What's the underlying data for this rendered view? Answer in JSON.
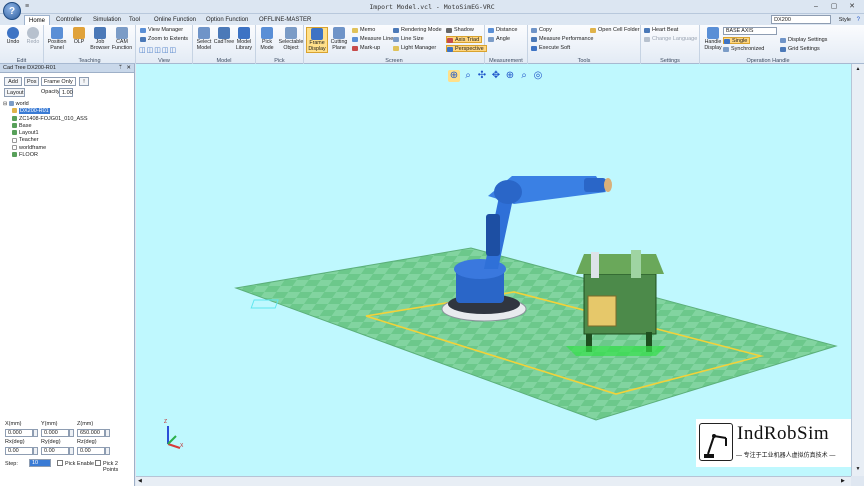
{
  "window": {
    "title": "Import Model.vcl - MotoSimEG-VRC",
    "orb_label": "?",
    "qat_label": "≡",
    "minimize": "–",
    "maximize": "▢",
    "close": "✕"
  },
  "tabs": [
    "Home",
    "Controller",
    "Simulation",
    "Tool",
    "Online Function",
    "Option Function",
    "OFFLINE-MASTER"
  ],
  "active_tab": "Home",
  "controller_select": "DX200",
  "style_label": "Style",
  "ribbon": {
    "edit": {
      "label": "Edit",
      "undo": "Undo",
      "redo": "Redo"
    },
    "teaching": {
      "label": "Teaching",
      "position_panel": "Position Panel",
      "olp": "OLP",
      "job_browser": "Job Browser",
      "cam_function": "CAM Function"
    },
    "view": {
      "label": "View",
      "view_manager": "View Manager",
      "zoom_to_extents": "Zoom to Extents"
    },
    "model": {
      "label": "Model",
      "select_model": "Select Model",
      "cadtree": "CadTree",
      "model_library": "Model Library"
    },
    "pick": {
      "label": "Pick",
      "pick_mode": "Pick Mode",
      "selectable_object": "Selectable Object"
    },
    "screen": {
      "label": "Screen",
      "frame_display": "Frame Display",
      "cutting_plane": "Cutting Plane",
      "memo": "Memo",
      "measure_line": "Measure Line",
      "markup": "Mark-up",
      "rendering_mode": "Rendering Mode",
      "line_size": "Line Size",
      "light_manager": "Light Manager",
      "shadow": "Shadow",
      "axis_triad": "Axis Triad",
      "perspective": "Perspective"
    },
    "measurement": {
      "label": "Measurement",
      "distance": "Distance",
      "angle": "Angle"
    },
    "tools": {
      "label": "Tools",
      "copy": "Copy",
      "measure_performance": "Measure Performance",
      "execute_soft": "Execute Soft",
      "open_cell_folder": "Open Cell Folder"
    },
    "settings": {
      "label": "Settings",
      "heart_beat": "Heart Beat",
      "change_language": "Change Language"
    },
    "operation_handle": {
      "label": "Operation Handle",
      "handle_display": "Handle Display",
      "axis_select": "BASE AXIS",
      "single": "Single",
      "synchronized": "Synchronized",
      "display_settings": "Display Settings",
      "grid_settings": "Grid Settings"
    }
  },
  "cad_tree": {
    "title": "Cad Tree DX200-R01",
    "pin": "ᛘ",
    "close": "✕",
    "add": "Add",
    "pos": "Pos",
    "frame_mode": "Frame Only",
    "layout": "Layout",
    "opacity_label": "Opacity:",
    "opacity_value": "1.00",
    "nodes": [
      {
        "label": "world",
        "level": 0
      },
      {
        "label": "DX200-R01",
        "level": 1
      },
      {
        "label": "ZC1408-FOJG01_010_ASS",
        "level": 1
      },
      {
        "label": "Base",
        "level": 1
      },
      {
        "label": "Layout1",
        "level": 1
      },
      {
        "label": "Teacher",
        "level": 1
      },
      {
        "label": "worldframe",
        "level": 1
      },
      {
        "label": "FLOOR",
        "level": 1
      }
    ],
    "selected_node": "DX200-R01",
    "fields": {
      "x_label": "X(mm)",
      "x_value": "0.000",
      "y_label": "Y(mm)",
      "y_value": "0.000",
      "z_label": "Z(mm)",
      "z_value": "650.000",
      "rx_label": "Rx(deg)",
      "rx_value": "0.00",
      "ry_label": "Ry(deg)",
      "ry_value": "0.00",
      "rz_label": "Rz(deg)",
      "rz_value": "0.00",
      "step_label": "Step:",
      "step_value": "10",
      "pick_enable": "Pick Enable",
      "pick_2points": "Pick 2 Points"
    }
  },
  "triad": {
    "z": "Z",
    "x": "X"
  },
  "watermark": {
    "name": "IndRobSim",
    "slogan": "— 专注于工业机器人虚拟仿真技术 —"
  }
}
